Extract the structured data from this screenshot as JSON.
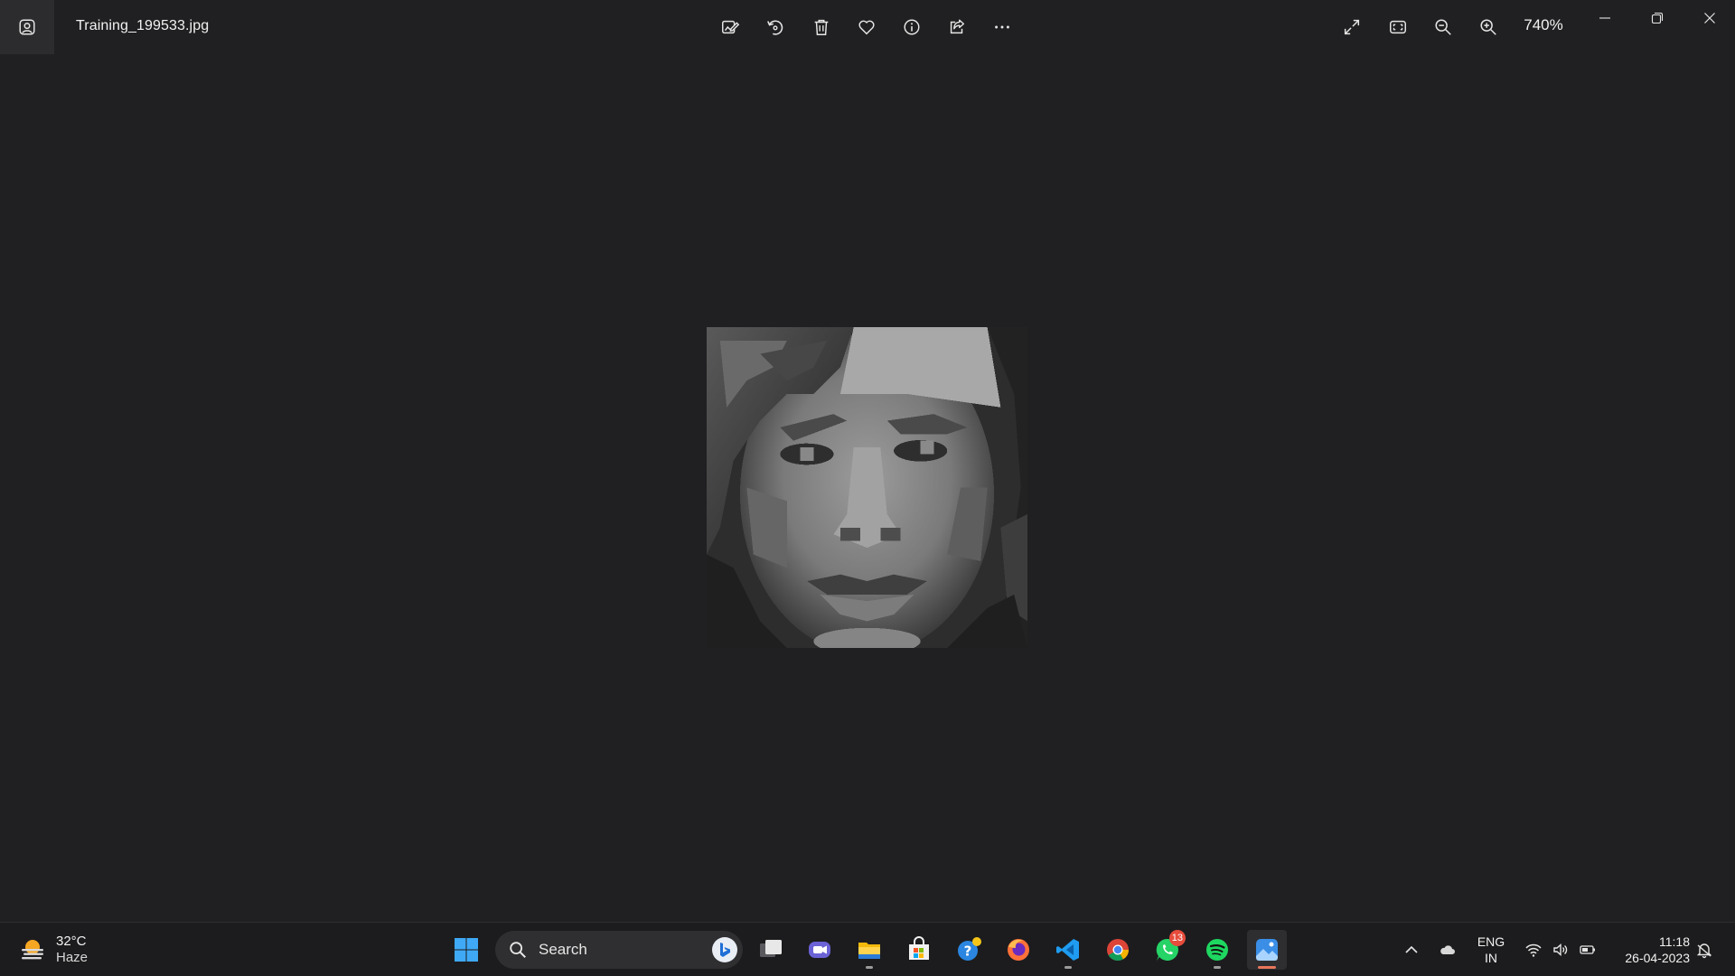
{
  "app": {
    "file_name": "Training_199533.jpg",
    "zoom": "740%",
    "photo_alt": "grayscale face photo"
  },
  "toolbar": {
    "items": [
      {
        "name": "edit-image-icon",
        "label": "Edit image"
      },
      {
        "name": "rotate-icon",
        "label": "Rotate"
      },
      {
        "name": "delete-icon",
        "label": "Delete"
      },
      {
        "name": "favorite-icon",
        "label": "Favorite"
      },
      {
        "name": "file-info-icon",
        "label": "File info"
      },
      {
        "name": "share-icon",
        "label": "Share"
      },
      {
        "name": "more-icon",
        "label": "See more"
      }
    ],
    "right": [
      {
        "name": "fullscreen-icon",
        "label": "Full screen"
      },
      {
        "name": "fit-to-window-icon",
        "label": "Fit to window"
      },
      {
        "name": "zoom-out-icon",
        "label": "Zoom out"
      },
      {
        "name": "zoom-in-icon",
        "label": "Zoom in"
      }
    ]
  },
  "taskbar": {
    "weather": {
      "temp": "32°C",
      "desc": "Haze"
    },
    "search": {
      "label": "Search"
    },
    "apps": [
      {
        "name": "start-button",
        "icon": "windows-logo"
      },
      {
        "name": "task-view",
        "icon": "task-view"
      },
      {
        "name": "teams-chat",
        "icon": "chat"
      },
      {
        "name": "file-explorer",
        "icon": "folder"
      },
      {
        "name": "microsoft-store",
        "icon": "store"
      },
      {
        "name": "get-help",
        "icon": "help"
      },
      {
        "name": "firefox",
        "icon": "firefox"
      },
      {
        "name": "vscode",
        "icon": "vscode"
      },
      {
        "name": "chrome",
        "icon": "chrome"
      },
      {
        "name": "whatsapp",
        "icon": "whatsapp",
        "badge": "13"
      },
      {
        "name": "spotify",
        "icon": "spotify"
      },
      {
        "name": "photos",
        "icon": "photos"
      }
    ],
    "tray": {
      "lang_line1": "ENG",
      "lang_line2": "IN",
      "time": "11:18",
      "date": "26-04-2023"
    }
  },
  "colors": {
    "background": "#202022",
    "taskbar": "#1c1c1e",
    "accent_running": "#e8765a"
  }
}
